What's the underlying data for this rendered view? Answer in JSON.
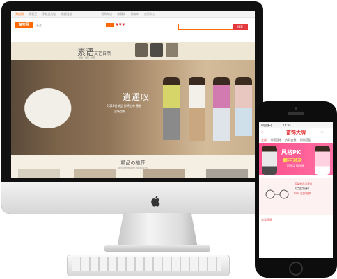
{
  "desktop_site": {
    "topbar_items": [
      "淘宝网",
      "我要买",
      "手机逛淘宝",
      "免费注册",
      "我的淘宝",
      "收藏夹",
      "购物车",
      "卖家中心"
    ],
    "logo_text": "淘宝网",
    "header_location": "浙江",
    "search_button": "搜索",
    "brand_title": "素语",
    "brand_title_suffix": "文艺自然",
    "brand_tagline": "随性 · 自然 · 文艺",
    "hero_title": "逍遥叹",
    "hero_sub": "6月13日新品 即将上市 预售",
    "hero_sub2": "全场包邮",
    "section_title": "精品の推荐",
    "section_sub": "RECOMMENDED PRODUCTS"
  },
  "mobile_site": {
    "status_carrier": "中国移动",
    "status_time": "14:24",
    "app_title": "蓄饰大牌",
    "tabs": [
      "全部",
      "带家园地",
      "大码女装",
      "时尚搭配"
    ],
    "banner_title": "风格PK",
    "banner_sub": "霸主对决",
    "banner_small": "夏装新品 限时抢购",
    "promo_line1": "【女装年货节】",
    "promo_line2": "【点此领券】",
    "promo_price": "¥99 立即抢购",
    "footer_label": "非常国际"
  },
  "colors": {
    "accent_orange": "#ff6a00",
    "accent_red": "#e4393c",
    "banner_pink": "#ff4f8b",
    "site_background": "#f5efe3"
  }
}
